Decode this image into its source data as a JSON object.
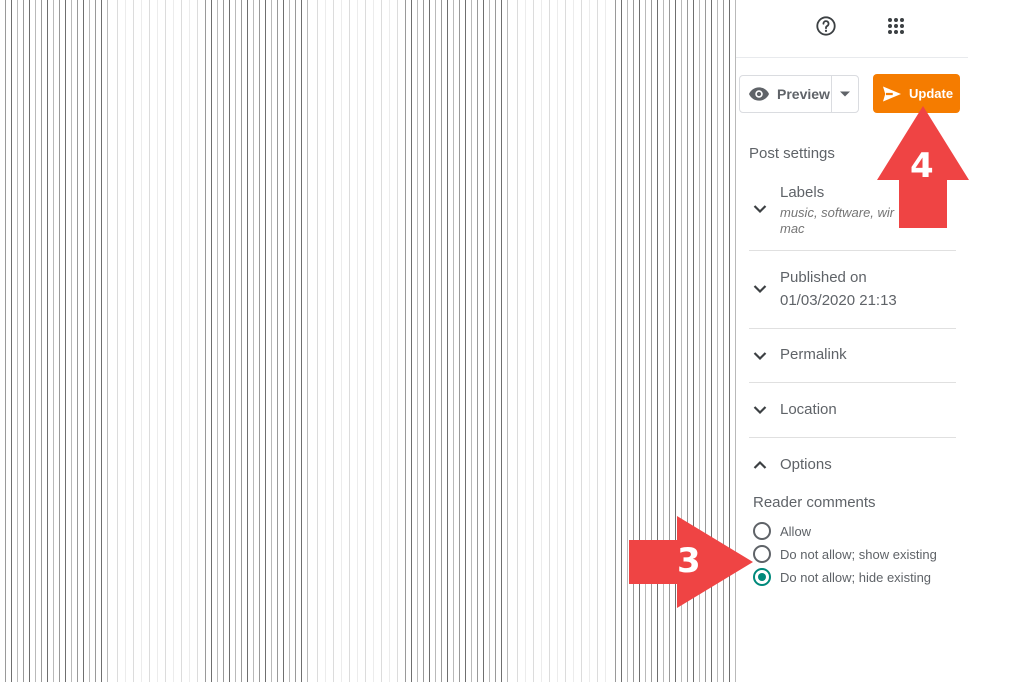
{
  "editor": {
    "content": "obfuscated-post-content"
  },
  "topbar": {
    "help_icon": "help-circle-icon",
    "apps_icon": "apps-grid-icon"
  },
  "actions": {
    "preview_label": "Preview",
    "preview_icon": "eye-icon",
    "preview_dropdown_icon": "caret-down-icon",
    "update_label": "Update",
    "update_icon": "send-icon"
  },
  "colors": {
    "update_bg": "#f57c00",
    "radio_checked": "#00897b",
    "annotation_arrow": "#ef4444",
    "text": "#5f6368"
  },
  "post_settings": {
    "title": "Post settings",
    "sections": [
      {
        "label": "Labels",
        "sub": "music, software, windows, mac",
        "sub_visible": "music, software, wir",
        "sub_line2": "mac",
        "expanded": false
      },
      {
        "label": "Published on",
        "value": "01/03/2020 21:13",
        "expanded": false
      },
      {
        "label": "Permalink",
        "expanded": false
      },
      {
        "label": "Location",
        "expanded": false
      },
      {
        "label": "Options",
        "expanded": true
      }
    ]
  },
  "options": {
    "reader_comments_title": "Reader comments",
    "choices": [
      {
        "label": "Allow",
        "checked": false
      },
      {
        "label": "Do not allow; show existing",
        "checked": false
      },
      {
        "label": "Do not allow; hide existing",
        "checked": true
      }
    ]
  },
  "annotations": [
    {
      "number": "3",
      "direction": "right",
      "target": "reader-comments-options"
    },
    {
      "number": "4",
      "direction": "up",
      "target": "update-button"
    }
  ]
}
